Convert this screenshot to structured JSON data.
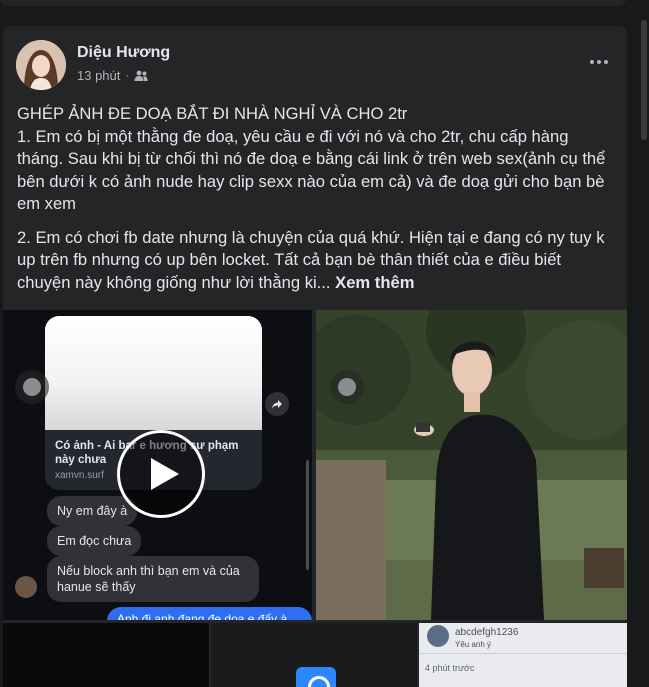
{
  "post": {
    "author": "Diệu Hương",
    "time": "13 phút",
    "separator": "·",
    "audience_icon": "friends-icon",
    "more_icon": "more-horizontal-icon",
    "paragraphs": [
      "GHÉP ẢNH ĐE DOẠ BẮT ĐI NHÀ NGHỈ VÀ CHO 2tr\n1. Em có bị một thằng đe doạ, yêu cầu e đi  với nó và cho 2tr, chu cấp hàng tháng. Sau khi bị từ chối thì nó đe doạ e bằng cái link ở trên web sex(ảnh cụ thể bên dưới k có ảnh nude hay clip sexx nào của em cả) và đe doạ gửi cho bạn bè em xem",
      "2. Em có chơi fb date nhưng là chuyện của quá khứ. Hiện tại e đang có ny tuy k up trên fb nhưng có up bên locket. Tất cả bạn bè thân thiết của e điều biết chuyện này không giống như lời thằng ki..."
    ],
    "see_more": "Xem thêm"
  },
  "media": {
    "chat": {
      "link_title": "Có ảnh - Ai bar e hương sư phạm này chưa",
      "link_domain": "xamvn.surf",
      "messages": [
        "Ny em đây à",
        "Em đọc chưa",
        "Nếu block anh thì bạn em và của hanue sẽ thấy"
      ],
      "sent_message": "Anh đi anh đang đe dọa e đấy à"
    },
    "thumb3": {
      "name": "abcdefgh1236",
      "sub": "Yêu anh ý",
      "time": "4 phút trước"
    }
  },
  "colors": {
    "page_bg": "#18191a",
    "card_bg": "#242526",
    "primary_text": "#e4e6eb",
    "secondary_text": "#b0b3b8",
    "messenger_blue": "#2e6ef0"
  }
}
